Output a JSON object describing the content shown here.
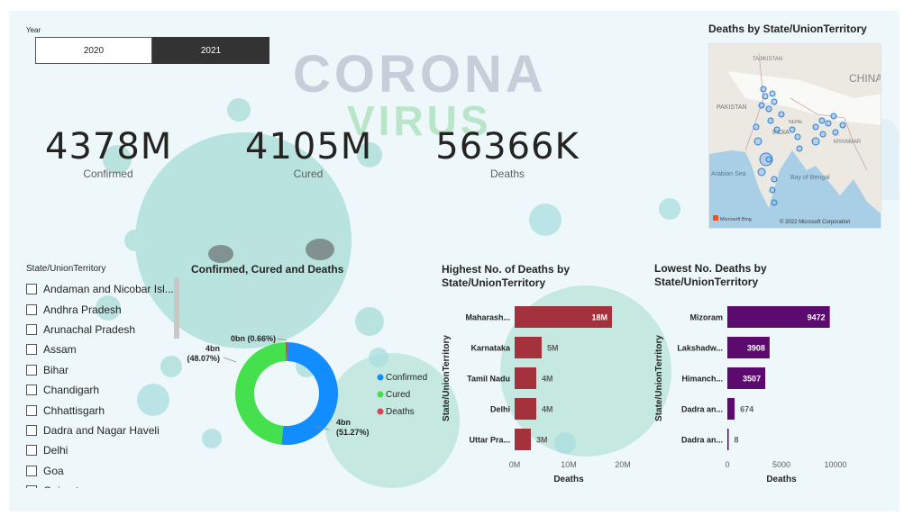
{
  "year_slicer": {
    "title": "Year",
    "options": [
      "2020",
      "2021"
    ],
    "selected": "2021"
  },
  "kpis": [
    {
      "value": "4378M",
      "label": "Confirmed"
    },
    {
      "value": "4105M",
      "label": "Cured"
    },
    {
      "value": "56366K",
      "label": "Deaths"
    }
  ],
  "state_slicer": {
    "title": "State/UnionTerritory",
    "items": [
      "Andaman and Nicobar Isl...",
      "Andhra Pradesh",
      "Arunachal Pradesh",
      "Assam",
      "Bihar",
      "Chandigarh",
      "Chhattisgarh",
      "Dadra and Nagar Haveli",
      "Delhi",
      "Goa",
      "Gujarat"
    ]
  },
  "map": {
    "title": "Deaths by State/UnionTerritory",
    "labels": [
      "PAKISTAN",
      "INDIA",
      "CHINA",
      "Bay of Bengal",
      "Arabian Sea",
      "MYANMAR",
      "NEPAL",
      "TAJIKISTAN"
    ],
    "attribution": "© 2022 Microsoft Corporation",
    "brand": "Microsoft Bing",
    "dot_color": "#2b7fd4"
  },
  "background": {
    "word1": "CORONA",
    "word2": "VIRUS"
  },
  "colors": {
    "confirmed": "#118dff",
    "cured": "#44e04d",
    "deaths": "#d64550",
    "bar_high": "#a4323d",
    "bar_low": "#5b0a6e",
    "virus": "#9dd9d2"
  },
  "chart_data": [
    {
      "type": "pie",
      "title": "Confirmed, Cured and Deaths",
      "categories": [
        "Confirmed",
        "Cured",
        "Deaths"
      ],
      "values": [
        4378,
        4105,
        56.366
      ],
      "data_labels": [
        "4bn (51.27%)",
        "4bn (48.07%)",
        "0bn (0.66%)"
      ],
      "legend": "right",
      "donut": true
    },
    {
      "type": "bar",
      "orientation": "horizontal",
      "title": "Highest No. of Deaths by State/UnionTerritory",
      "categories": [
        "Maharash...",
        "Karnataka",
        "Tamil Nadu",
        "Delhi",
        "Uttar Pra..."
      ],
      "values": [
        18,
        5,
        4,
        4,
        3
      ],
      "data_labels": [
        "18M",
        "5M",
        "4M",
        "4M",
        "3M"
      ],
      "xlabel": "Deaths",
      "ylabel": "State/UnionTerritory",
      "xticks": [
        "0M",
        "10M",
        "20M"
      ],
      "xlim": [
        0,
        20
      ]
    },
    {
      "type": "bar",
      "orientation": "horizontal",
      "title": "Lowest No. Deaths by State/UnionTerritory",
      "categories": [
        "Mizoram",
        "Lakshadw...",
        "Himanch...",
        "Dadra an...",
        "Dadra an..."
      ],
      "values": [
        9472,
        3908,
        3507,
        674,
        8
      ],
      "data_labels": [
        "9472",
        "3908",
        "3507",
        "674",
        "8"
      ],
      "xlabel": "Deaths",
      "ylabel": "State/UnionTerritory",
      "xticks": [
        "0",
        "5000",
        "10000"
      ],
      "xlim": [
        0,
        10000
      ]
    }
  ]
}
